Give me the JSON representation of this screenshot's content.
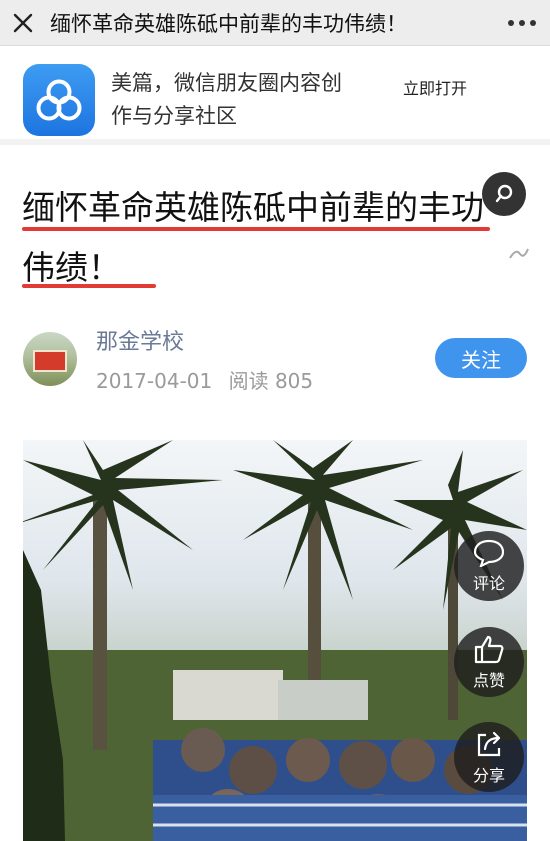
{
  "window": {
    "title": "缅怀革命英雄陈砥中前辈的丰功伟绩！"
  },
  "promo": {
    "app_name_line1": "美篇，微信朋友圈内容创",
    "app_name_line2": "作与分享社区",
    "open_label": "立即打开",
    "accent": "#3f94ee"
  },
  "article": {
    "title": "缅怀革命英雄陈砥中前辈的丰功伟绩！",
    "underline_color": "#e23b35",
    "author": "那金学校",
    "date": "2017-04-01",
    "reads_label": "阅读",
    "reads": "805",
    "follow_label": "关注"
  },
  "side_actions": {
    "comment_label": "评论",
    "like_label": "点赞",
    "share_label": "分享"
  },
  "icons": [
    "close-icon",
    "more-icon",
    "app-logo-icon",
    "search-icon",
    "link-icon",
    "comment-icon",
    "like-icon",
    "share-icon"
  ]
}
